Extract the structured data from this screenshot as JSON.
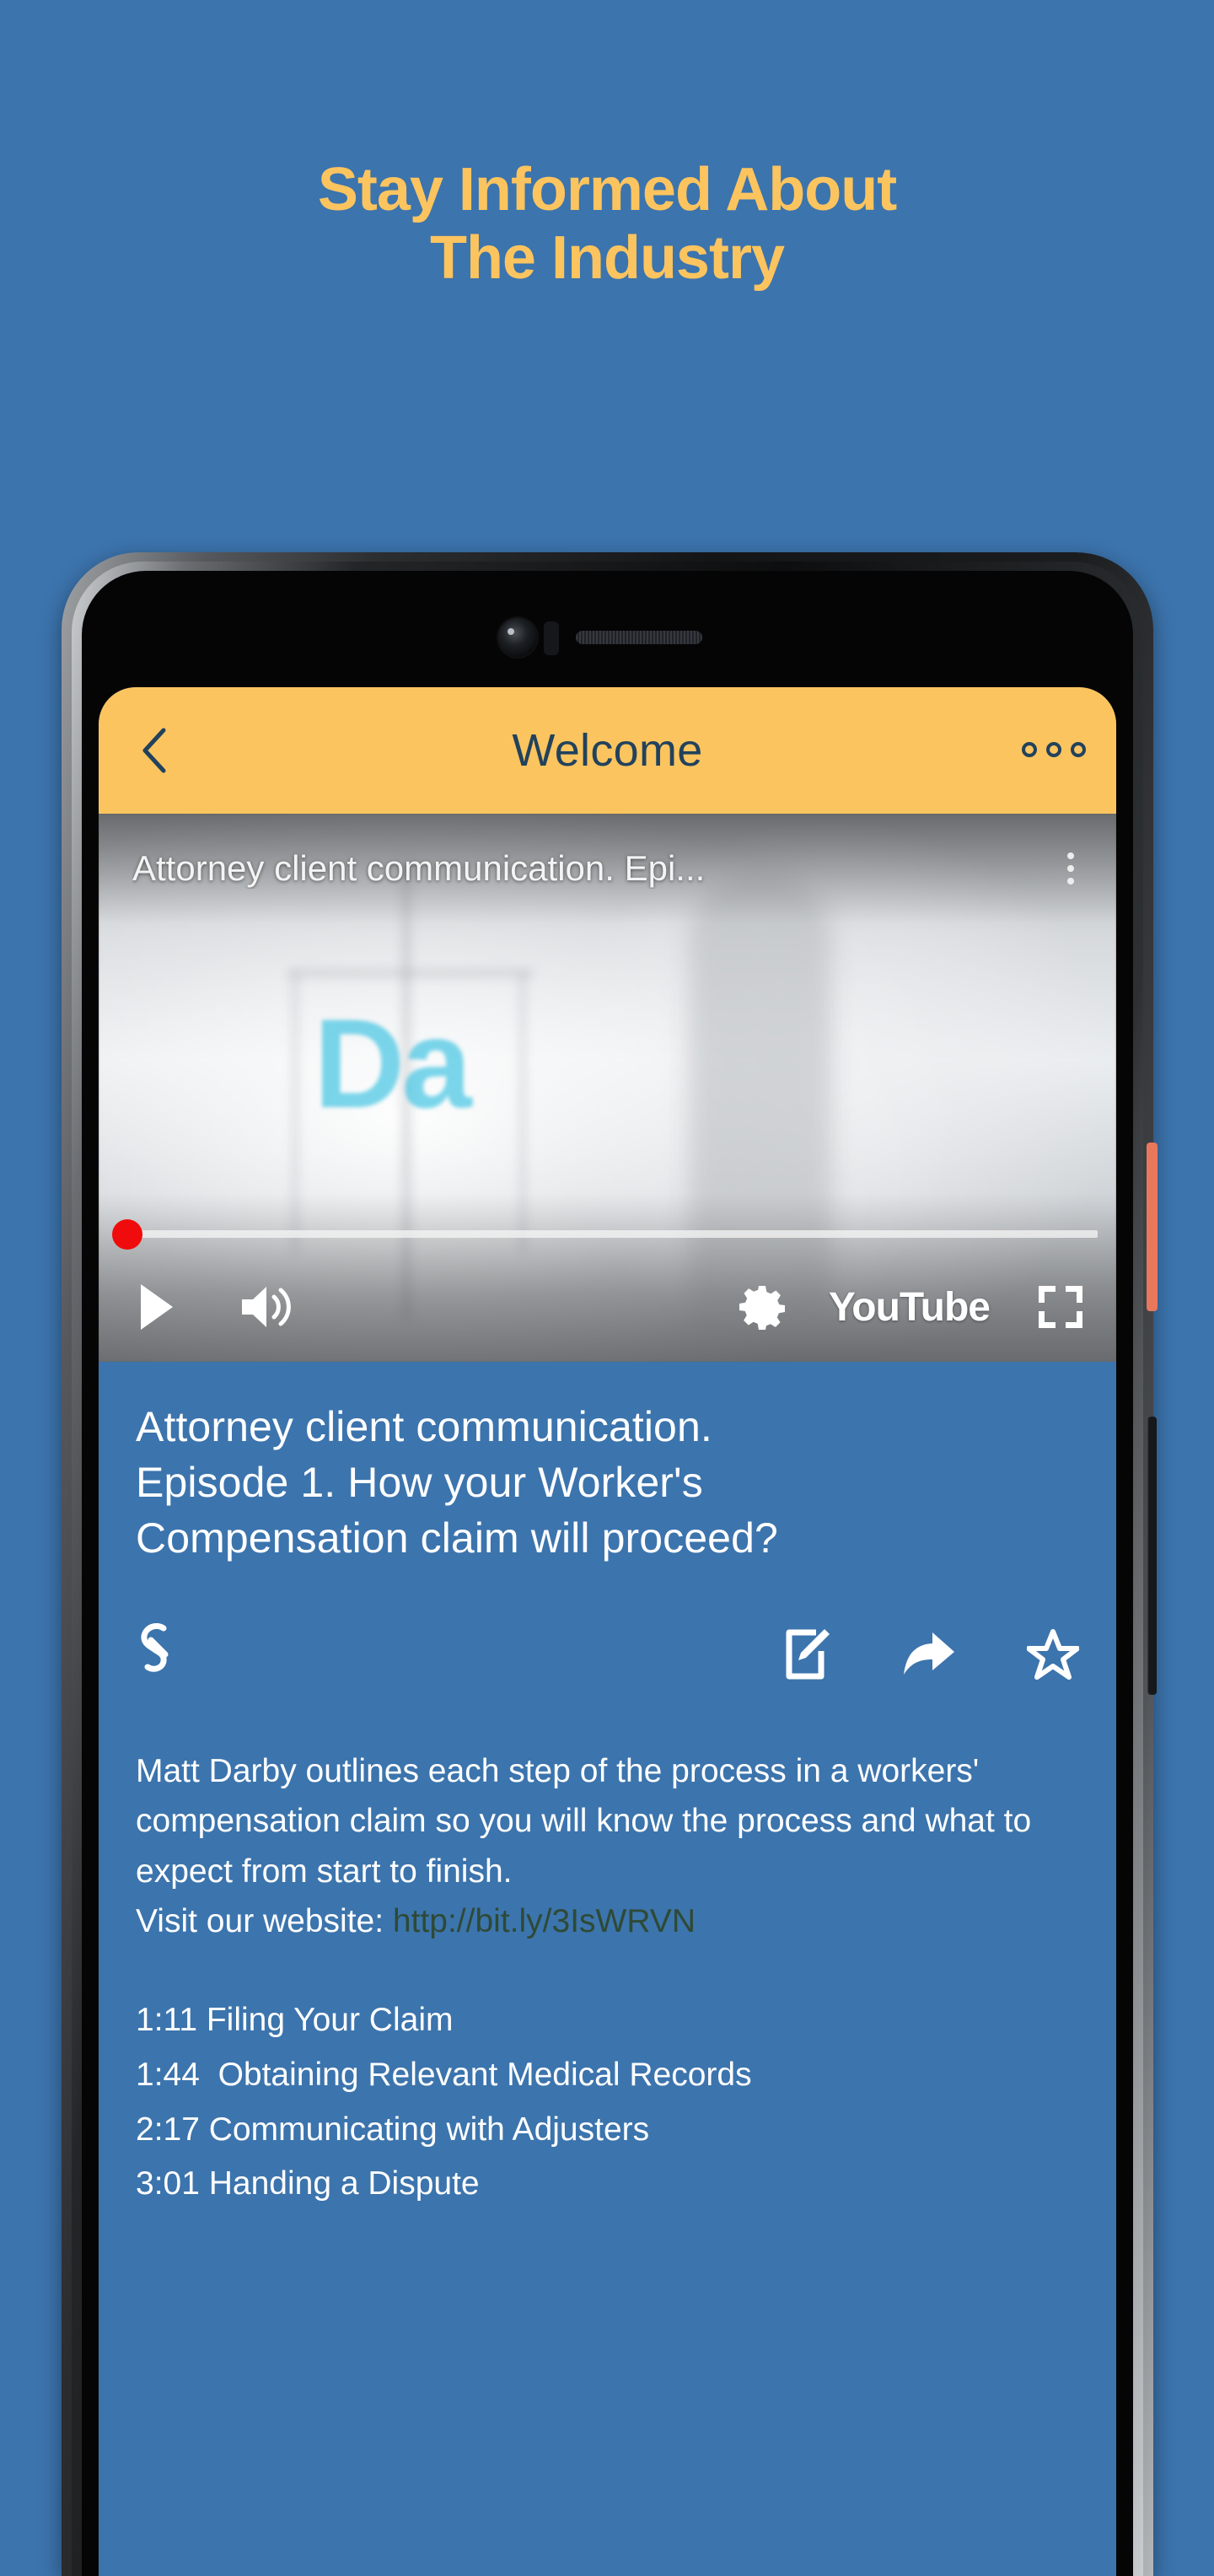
{
  "promo": {
    "headline": "Stay Informed About\nThe Industry",
    "accent_color": "#fcc45f",
    "background_color": "#3c74ad"
  },
  "appbar": {
    "title": "Welcome",
    "back_icon": "chevron-left-icon",
    "more_icon": "overflow-menu-icon",
    "background_color": "#fbc45f",
    "text_color": "#22425c"
  },
  "player": {
    "overlay_title": "Attorney client communication. Epi...",
    "kebab_icon": "vertical-dots-icon",
    "brand_watermark": "Da",
    "controls": {
      "play_icon": "play-icon",
      "volume_icon": "volume-icon",
      "settings_icon": "gear-icon",
      "youtube_label": "YouTube",
      "fullscreen_icon": "fullscreen-icon",
      "progress_percent": 0,
      "scrubber_color": "#f00c0c"
    }
  },
  "video": {
    "heading": "Attorney client communication.\nEpisode 1. How your Worker's\nCompensation claim will proceed?",
    "actions": [
      {
        "name": "link-icon",
        "label": "Link"
      },
      {
        "name": "edit-icon",
        "label": "Edit"
      },
      {
        "name": "share-icon",
        "label": "Share"
      },
      {
        "name": "star-icon",
        "label": "Favorite"
      }
    ],
    "description": "Matt Darby outlines each step of the process in a workers' compensation claim so you will know the process and what to expect from start to finish.",
    "website_label": "Visit our website: ",
    "website_url": "http://bit.ly/3IsWRVN",
    "chapters": [
      {
        "time": "1:11",
        "title": "Filing Your Claim",
        "text": "1:11 Filing Your Claim"
      },
      {
        "time": "1:44",
        "title": "Obtaining Relevant Medical Records",
        "text": "1:44  Obtaining Relevant Medical Records"
      },
      {
        "time": "2:17",
        "title": "Communicating with Adjusters",
        "text": "2:17 Communicating with Adjusters"
      },
      {
        "time": "3:01",
        "title": "Handing a Dispute",
        "text": "3:01 Handing a Dispute"
      }
    ]
  },
  "device": {
    "power_button": "power-button",
    "volume_button": "volume-rocker",
    "camera": "front-camera",
    "earpiece": "earpiece-speaker"
  }
}
